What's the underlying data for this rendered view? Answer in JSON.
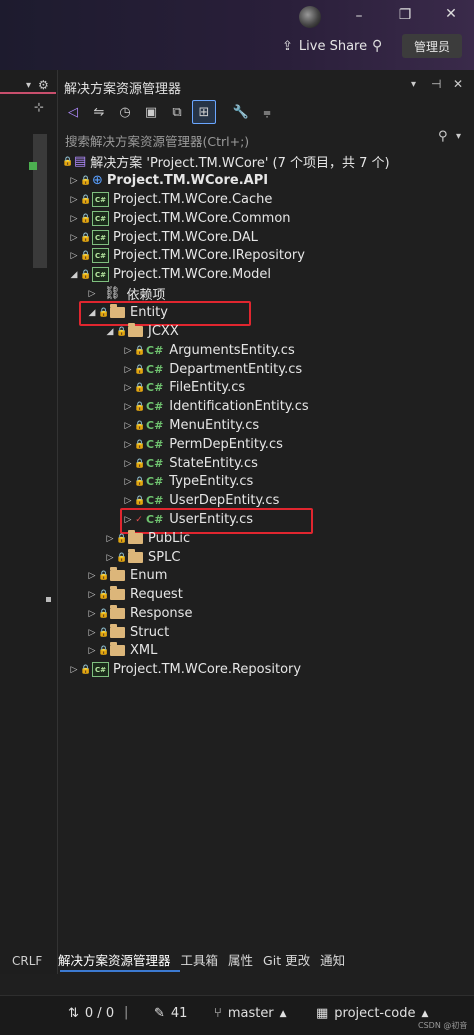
{
  "titlebar": {
    "live_share_label": "Live Share",
    "admin_label": "管理员"
  },
  "panel": {
    "title": "解决方案资源管理器",
    "search_placeholder": "搜索解决方案资源管理器(Ctrl+;)"
  },
  "tree": {
    "solution": "解决方案 'Project.TM.WCore' (7 个项目，共 7 个)",
    "projects": {
      "api": "Project.TM.WCore.API",
      "cache": "Project.TM.WCore.Cache",
      "common": "Project.TM.WCore.Common",
      "dal": "Project.TM.WCore.DAL",
      "irepository": "Project.TM.WCore.IRepository",
      "model": "Project.TM.WCore.Model",
      "repository": "Project.TM.WCore.Repository"
    },
    "dependencies": "依赖项",
    "entity": "Entity",
    "jcxx": "JCXX",
    "files": [
      "ArgumentsEntity.cs",
      "DepartmentEntity.cs",
      "FileEntity.cs",
      "IdentificationEntity.cs",
      "MenuEntity.cs",
      "PermDepEntity.cs",
      "StateEntity.cs",
      "TypeEntity.cs",
      "UserDepEntity.cs",
      "UserEntity.cs"
    ],
    "public": "PubLic",
    "splc": "SPLC",
    "folders": [
      "Enum",
      "Request",
      "Response",
      "Struct",
      "XML"
    ],
    "cs_glyph": "C#"
  },
  "tabs": [
    "解决方案资源管理器",
    "工具箱",
    "属性",
    "Git 更改",
    "通知"
  ],
  "left": {
    "crlf": "CRLF"
  },
  "statusbar": {
    "changes": "0 / 0",
    "edits": "41",
    "branch": "master",
    "repo": "project-code"
  },
  "watermark": "CSDN @初音",
  "colors": {
    "highlight_box": "#e0262f",
    "folder": "#dcb67a",
    "csharp": "#6fc26f",
    "lock": "#5aa0ff"
  }
}
